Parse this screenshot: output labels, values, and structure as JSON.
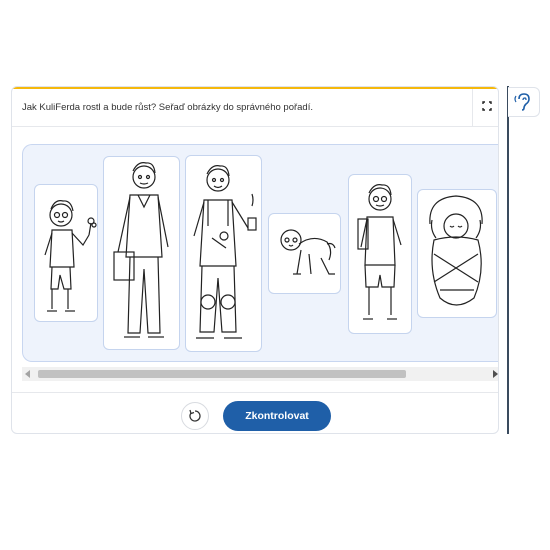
{
  "task": {
    "prompt": "Jak KuliFerda rostl a bude růst? Seřaď obrázky do správného pořadí."
  },
  "tiles": [
    {
      "name": "tile-child-with-flower",
      "icon": "child-with-flower-drawing"
    },
    {
      "name": "tile-man-with-briefcase",
      "icon": "adult-man-drawing"
    },
    {
      "name": "tile-worker-with-tools",
      "icon": "worker-drawing"
    },
    {
      "name": "tile-crawling-toddler",
      "icon": "crawling-baby-drawing"
    },
    {
      "name": "tile-schoolboy-with-backpack",
      "icon": "schoolboy-drawing"
    },
    {
      "name": "tile-swaddled-baby",
      "icon": "swaddled-baby-drawing"
    }
  ],
  "footer": {
    "check_label": "Zkontrolovat"
  },
  "colors": {
    "accent": "#f5b80b",
    "primary_button": "#1f5fa8",
    "stage_bg": "#eef3fc",
    "tile_border": "#c5d4ee",
    "sidebar_icon": "#1f5fa8"
  },
  "icons": {
    "fullscreen": "fullscreen-icon",
    "reset": "reset-icon",
    "accessibility": "ear-icon"
  }
}
